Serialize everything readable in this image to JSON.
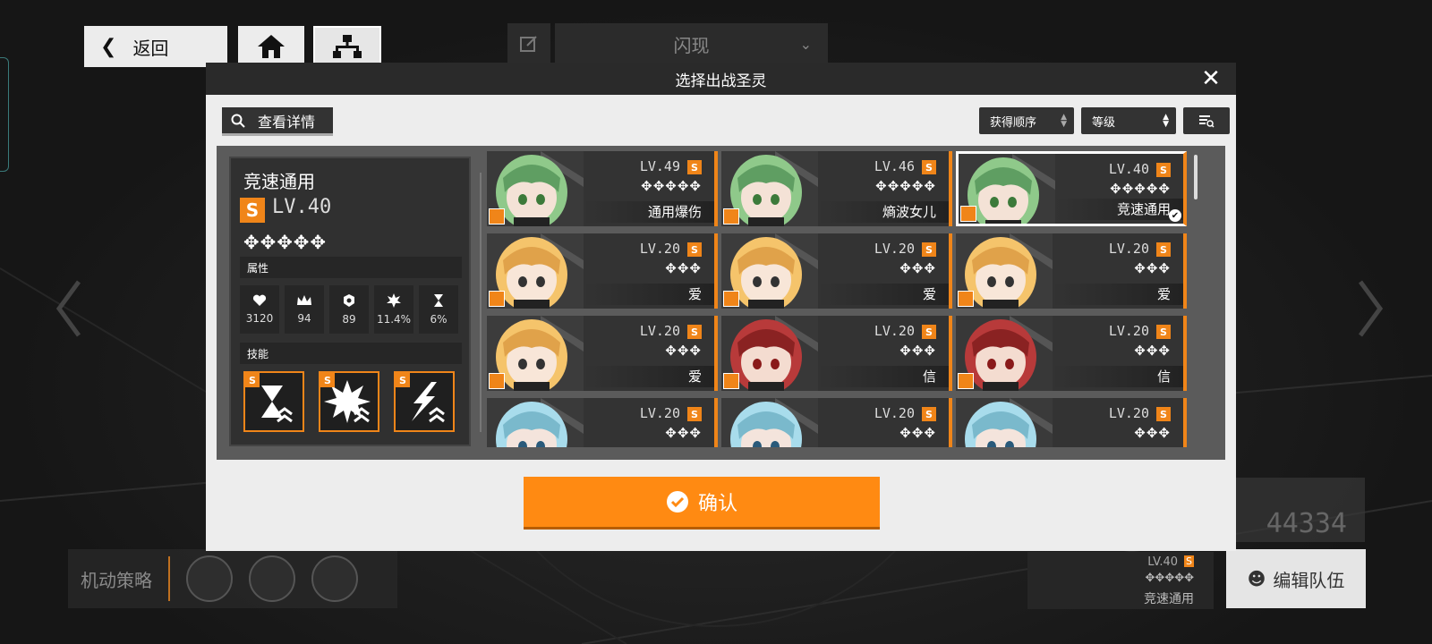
{
  "top": {
    "back_label": "返回",
    "mode_select": "闪现"
  },
  "modal": {
    "title": "选择出战圣灵",
    "details_label": "查看详情",
    "filters": [
      "获得顺序",
      "等级"
    ],
    "confirm_label": "确认"
  },
  "detail": {
    "name": "竞速通用",
    "rank": "S",
    "level": "LV.40",
    "stars": "✥✥✥✥✥",
    "attr_header": "属性",
    "skill_header": "技能",
    "stats": [
      "3120",
      "94",
      "89",
      "11.4%",
      "6%"
    ],
    "skill_badges": [
      "S",
      "S",
      "S"
    ]
  },
  "cards": [
    {
      "level": "LV.49",
      "rank": "S",
      "stars": "✥✥✥✥✥",
      "name": "通用爆伤",
      "char": "green"
    },
    {
      "level": "LV.46",
      "rank": "S",
      "stars": "✥✥✥✥✥",
      "name": "熵波女儿",
      "char": "green"
    },
    {
      "level": "LV.40",
      "rank": "S",
      "stars": "✥✥✥✥✥",
      "name": "竞速通用",
      "char": "green",
      "selected": true
    },
    {
      "level": "LV.20",
      "rank": "S",
      "stars": "✥✥✥",
      "name": "爱",
      "char": "blonde"
    },
    {
      "level": "LV.20",
      "rank": "S",
      "stars": "✥✥✥",
      "name": "爱",
      "char": "blonde"
    },
    {
      "level": "LV.20",
      "rank": "S",
      "stars": "✥✥✥",
      "name": "爱",
      "char": "blonde"
    },
    {
      "level": "LV.20",
      "rank": "S",
      "stars": "✥✥✥",
      "name": "爱",
      "char": "blonde"
    },
    {
      "level": "LV.20",
      "rank": "S",
      "stars": "✥✥✥",
      "name": "信",
      "char": "red"
    },
    {
      "level": "LV.20",
      "rank": "S",
      "stars": "✥✥✥",
      "name": "信",
      "char": "red"
    },
    {
      "level": "LV.20",
      "rank": "S",
      "stars": "✥✥✥",
      "name": "",
      "char": "cyan"
    },
    {
      "level": "LV.20",
      "rank": "S",
      "stars": "✥✥✥",
      "name": "",
      "char": "cyan"
    },
    {
      "level": "LV.20",
      "rank": "S",
      "stars": "✥✥✥",
      "name": "",
      "char": "cyan"
    }
  ],
  "background": {
    "strategy_label": "机动策略",
    "team_score": "44334",
    "mini_card": {
      "level": "LV.40",
      "rank": "S",
      "stars": "✥✥✥✥✥",
      "name": "竞速通用"
    },
    "edit_team_label": "编辑队伍"
  },
  "colors": {
    "accent": "#f08519",
    "confirm": "#ff8a12"
  }
}
